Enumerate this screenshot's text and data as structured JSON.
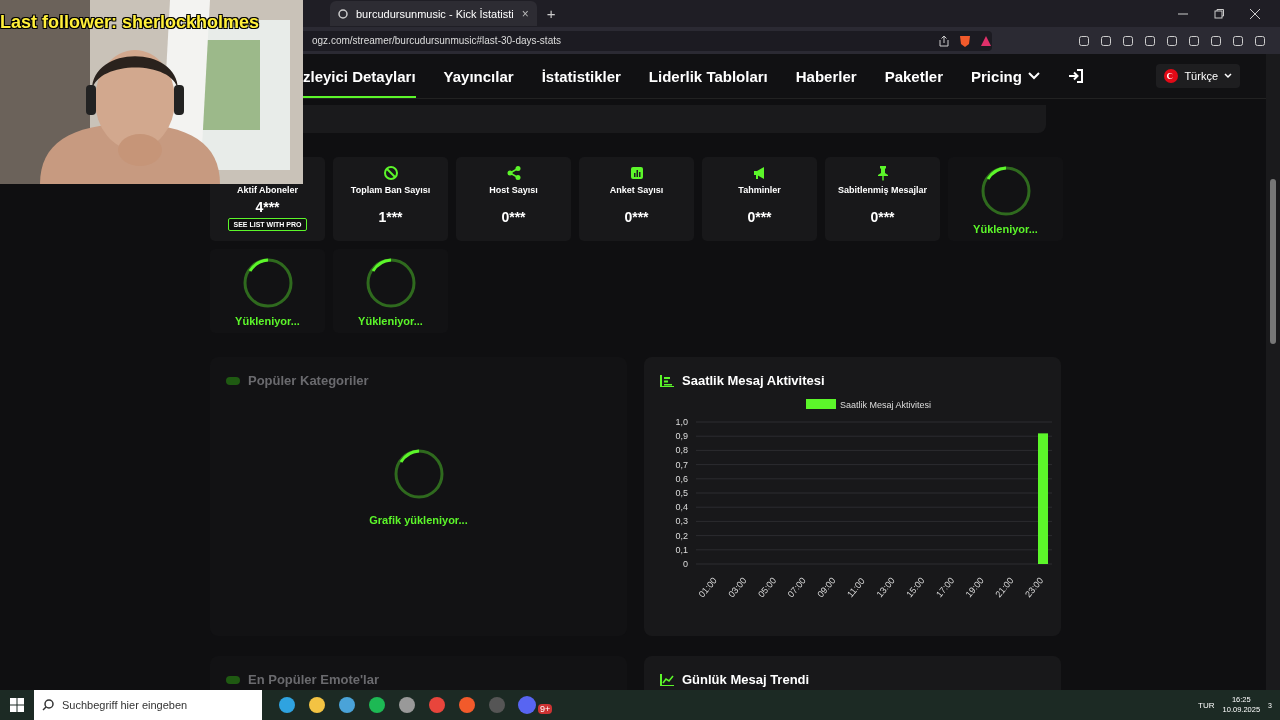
{
  "browser": {
    "tabs": [
      {
        "title": "burcudursunmusic - Kick İstatisti",
        "selected": true,
        "close": "×"
      }
    ],
    "new_tab": "+",
    "url": "ogz.com/streamer/burcudursunmusic#last-30-days-stats"
  },
  "overlay": {
    "text": "Last follower: sherlockholmes"
  },
  "nav": {
    "items": [
      {
        "label": "zleyici Detayları",
        "selected": true
      },
      {
        "label": "Yayıncılar",
        "selected": false
      },
      {
        "label": "İstatistikler",
        "selected": false
      },
      {
        "label": "Liderlik Tabloları",
        "selected": false
      },
      {
        "label": "Haberler",
        "selected": false
      },
      {
        "label": "Paketler",
        "selected": false
      },
      {
        "label": "Pricing",
        "selected": false
      }
    ],
    "language": "Türkçe"
  },
  "stats": [
    {
      "kind": "stat",
      "label": "Aktif Aboneler",
      "value": "4***",
      "button": "SEE LIST WITH PRO"
    },
    {
      "kind": "stat",
      "label": "Toplam Ban Sayısı",
      "value": "1***"
    },
    {
      "kind": "stat",
      "label": "Host Sayısı",
      "value": "0***"
    },
    {
      "kind": "stat",
      "label": "Anket Sayısı",
      "value": "0***"
    },
    {
      "kind": "stat",
      "label": "Tahminler",
      "value": "0***"
    },
    {
      "kind": "stat",
      "label": "Sabitlenmiş Mesajlar",
      "value": "0***"
    },
    {
      "kind": "loading",
      "status": "Yükleniyor..."
    },
    {
      "kind": "loading",
      "status": "Yükleniyor..."
    },
    {
      "kind": "loading",
      "status": "Yükleniyor..."
    }
  ],
  "panels": [
    {
      "kind": "loading",
      "title": "Popüler Kategoriler",
      "status": "Grafik yükleniyor..."
    },
    {
      "kind": "chart",
      "title": "Saatlik Mesaj Aktivitesi",
      "chart_data": {
        "type": "bar",
        "grid": true,
        "categories": [
          "01:00",
          "03:00",
          "05:00",
          "07:00",
          "09:00",
          "11:00",
          "13:00",
          "15:00",
          "17:00",
          "19:00",
          "21:00",
          "23:00"
        ],
        "series": [
          {
            "name": "Saatlik Mesaj Aktivitesi",
            "color": "#5cf62a",
            "values": [
              0,
              0,
              0,
              0,
              0,
              0,
              0,
              0,
              0,
              0,
              0,
              0.92
            ]
          }
        ],
        "ylim": [
          0,
          1
        ],
        "yticks": [
          {
            "value": 0,
            "label": "0"
          },
          {
            "value": 0.1,
            "label": "0,1"
          },
          {
            "value": 0.2,
            "label": "0,2"
          },
          {
            "value": 0.3,
            "label": "0,3"
          },
          {
            "value": 0.4,
            "label": "0,4"
          },
          {
            "value": 0.5,
            "label": "0,5"
          },
          {
            "value": 0.6,
            "label": "0,6"
          },
          {
            "value": 0.7,
            "label": "0,7"
          },
          {
            "value": 0.8,
            "label": "0,8"
          },
          {
            "value": 0.9,
            "label": "0,9"
          },
          {
            "value": 1,
            "label": "1,0"
          }
        ]
      }
    },
    {
      "kind": "loading",
      "title": "En Popüler Emote'lar"
    },
    {
      "kind": "trend",
      "title": "Günlük Mesaj Trendi"
    }
  ],
  "taskbar": {
    "search_placeholder": "Suchbegriff hier eingeben",
    "badge": "9+",
    "language": "TUR",
    "time": "16:25",
    "date": "10.09.2025",
    "notifications": "3"
  }
}
